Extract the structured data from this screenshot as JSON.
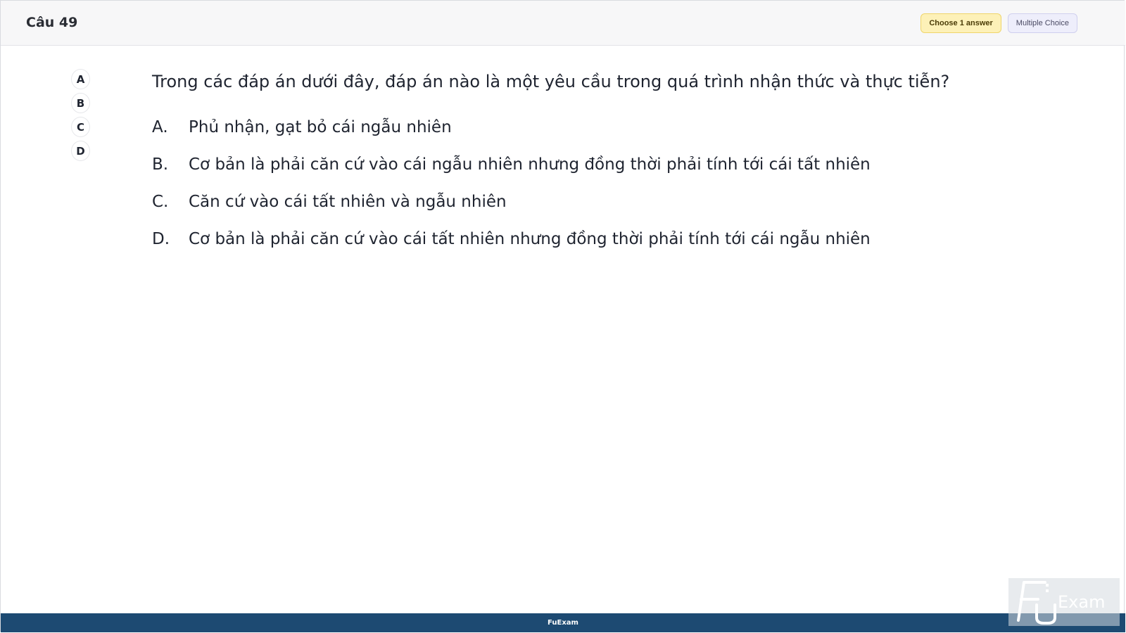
{
  "header": {
    "question_number": "Câu 49",
    "choose_badge": "Choose 1 answer",
    "type_badge": "Multiple Choice"
  },
  "answer_nav": [
    "A",
    "B",
    "C",
    "D"
  ],
  "question": {
    "text": "Trong các đáp án dưới đây, đáp án nào là một yêu cầu trong quá trình nhận thức và thực tiễn?",
    "options": [
      {
        "letter": "A.",
        "text": "Phủ nhận, gạt bỏ cái ngẫu nhiên"
      },
      {
        "letter": "B.",
        "text": "Cơ bản là phải căn cứ vào cái ngẫu nhiên nhưng đồng thời phải tính tới cái tất nhiên"
      },
      {
        "letter": "C.",
        "text": "Căn cứ vào cái tất nhiên và ngẫu nhiên"
      },
      {
        "letter": "D.",
        "text": "Cơ bản là phải căn cứ vào cái tất nhiên nhưng đồng thời phải tính tới cái ngẫu nhiên"
      }
    ]
  },
  "footer": {
    "label": "FuExam"
  },
  "watermark": {
    "text": "FU Exam",
    "icon": "fuexam-logo-icon"
  }
}
